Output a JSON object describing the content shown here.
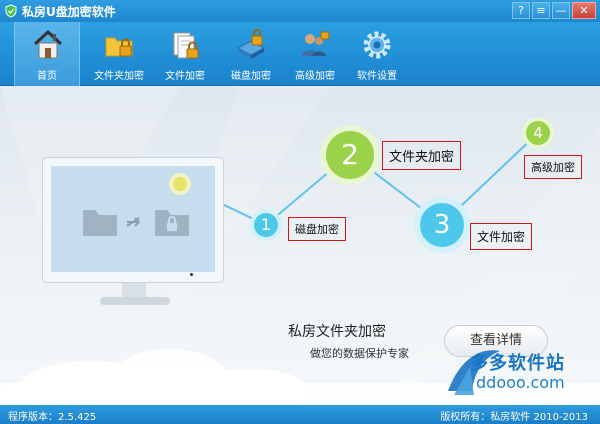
{
  "window": {
    "title": "私房U盘加密软件",
    "buttons": [
      "?",
      "≡",
      "—",
      "✕"
    ]
  },
  "toolbar": {
    "items": [
      {
        "label": "首页",
        "icon": "home-icon",
        "active": true
      },
      {
        "label": "文件夹加密",
        "icon": "folder-lock-icon",
        "active": false
      },
      {
        "label": "文件加密",
        "icon": "file-lock-icon",
        "active": false
      },
      {
        "label": "磁盘加密",
        "icon": "disk-lock-icon",
        "active": false
      },
      {
        "label": "高级加密",
        "icon": "users-lock-icon",
        "active": false
      },
      {
        "label": "软件设置",
        "icon": "gear-icon",
        "active": false
      }
    ]
  },
  "steps": [
    {
      "num": "1",
      "label": "磁盘加密"
    },
    {
      "num": "2",
      "label": "文件夹加密"
    },
    {
      "num": "3",
      "label": "文件加密"
    },
    {
      "num": "4",
      "label": "高级加密"
    }
  ],
  "promo": {
    "title": "私房文件夹加密",
    "subtitle": "做您的数据保护专家",
    "button": "查看详情"
  },
  "watermark": {
    "cn": "多多软件站",
    "en": "ddooo.com"
  },
  "status": {
    "version": "程序版本：2.5.425",
    "copyright": "版权所有：私房软件 2010-2013"
  },
  "colors": {
    "accent": "#1e88d2",
    "step_green": "#9ad34a",
    "step_blue": "#4ec8ea",
    "label_border": "#d01818"
  }
}
